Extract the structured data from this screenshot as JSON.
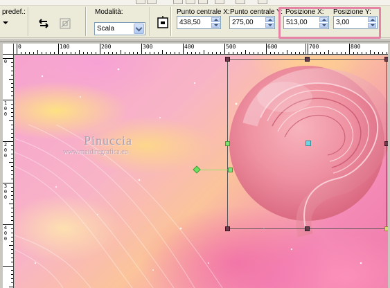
{
  "toolbar": {
    "preset_label": "predef.:",
    "mode_label": "Modalità:",
    "mode_value": "Scala",
    "center_x_label": "Punto centrale X:",
    "center_x_value": "438,50",
    "center_y_label": "Punto centrale Y:",
    "center_y_value": "275,00",
    "pos_x_label": "Posizione X:",
    "pos_x_value": "513,00",
    "pos_y_label": "Posizione Y:",
    "pos_y_value": "3,00",
    "highlight_color": "#e684a6"
  },
  "ruler": {
    "horizontal_labels": [
      "0",
      "100",
      "200",
      "300",
      "400",
      "500",
      "600",
      "700",
      "800"
    ],
    "vertical_labels": [
      [
        "0"
      ],
      [
        "1",
        "0",
        "0"
      ],
      [
        "2",
        "0",
        "0"
      ],
      [
        "3",
        "0",
        "0"
      ],
      [
        "4",
        "0",
        "0"
      ]
    ]
  },
  "canvas": {
    "watermark": "Pinuccia",
    "watermark_url": "www.maidiregrafica.eu"
  },
  "icons": {
    "reset": "reset-arrows-icon",
    "transform": "free-transform-icon",
    "move_toggle": "move-selection-icon"
  }
}
